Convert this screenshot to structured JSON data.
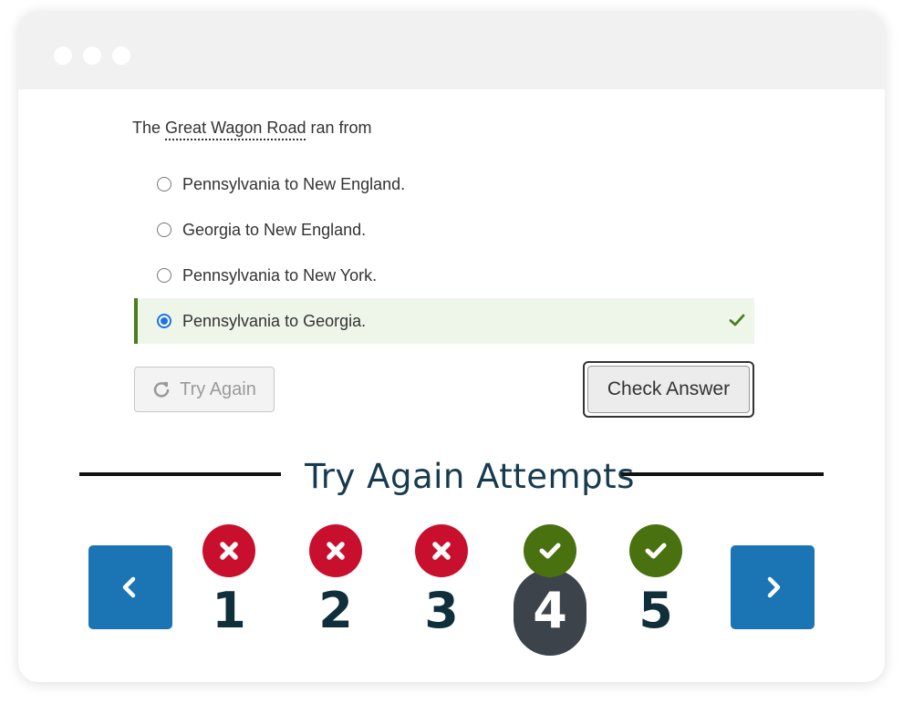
{
  "window": {
    "dots": [
      "dot",
      "dot",
      "dot"
    ]
  },
  "question": {
    "prefix": "The",
    "term": "Great Wagon Road",
    "suffix": "ran from"
  },
  "options": [
    {
      "label": "Pennsylvania to New England.",
      "selected": false
    },
    {
      "label": "Georgia to New England.",
      "selected": false
    },
    {
      "label": "Pennsylvania to New York.",
      "selected": false
    },
    {
      "label": "Pennsylvania to Georgia.",
      "selected": true,
      "status": "correct",
      "status_icon": "check-icon"
    }
  ],
  "buttons": {
    "try_again": "Try Again",
    "try_again_icon": "refresh-icon",
    "check_answer": "Check Answer"
  },
  "attempts": {
    "title": "Try Again Attempts",
    "prev_icon": "chevron-left-icon",
    "next_icon": "chevron-right-icon",
    "items": [
      {
        "number": "1",
        "result": "wrong"
      },
      {
        "number": "2",
        "result": "wrong"
      },
      {
        "number": "3",
        "result": "wrong"
      },
      {
        "number": "4",
        "result": "right",
        "current": true
      },
      {
        "number": "5",
        "result": "right"
      }
    ]
  },
  "colors": {
    "correct_green": "#4a7e1a",
    "wrong_red": "#c8102e",
    "nav_blue": "#1b74b4",
    "heading_navy": "#173b4e"
  }
}
